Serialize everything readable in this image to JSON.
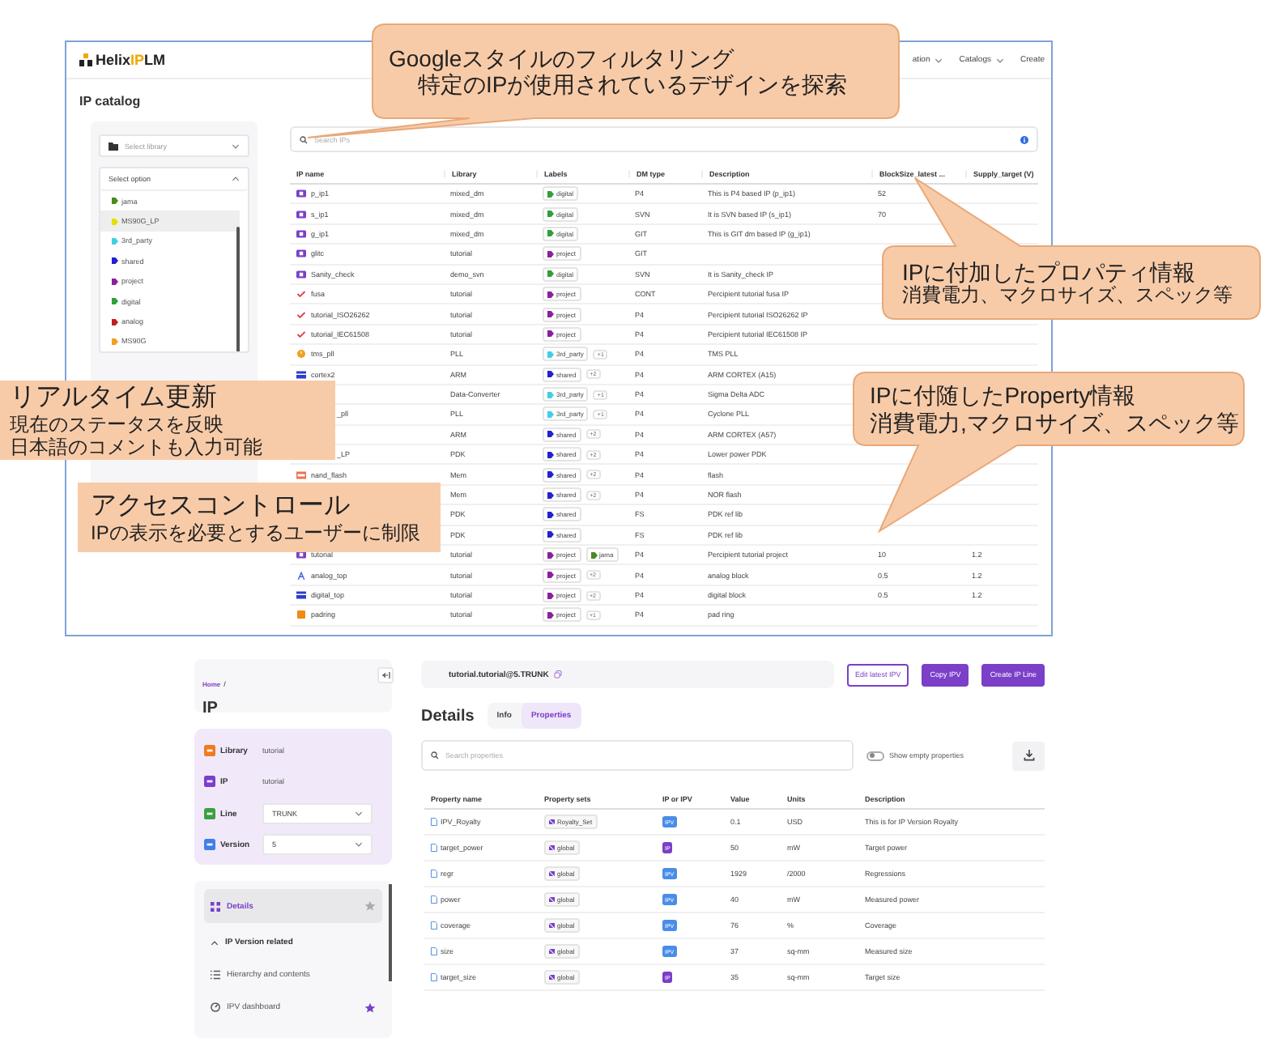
{
  "catalog_window": {
    "header": {
      "logo": {
        "part_1": "Helix",
        "part_2": "IP",
        "part_3": "LM"
      },
      "nav": [
        {
          "label": "ation",
          "dropdown": true
        },
        {
          "label": "Catalogs",
          "dropdown": true
        },
        {
          "label": "Create",
          "dropdown": false
        }
      ]
    },
    "title": "IP catalog",
    "library_select": {
      "placeholder": "Select library"
    },
    "option_select": {
      "placeholder": "Select option",
      "expanded": true,
      "options": [
        {
          "label": "jama",
          "color": "#4a8a20",
          "selected": false
        },
        {
          "label": "MS90G_LP",
          "color": "#e3e000",
          "selected": true
        },
        {
          "label": "3rd_party",
          "color": "#40cfe6",
          "selected": false
        },
        {
          "label": "shared",
          "color": "#2222d0",
          "selected": false
        },
        {
          "label": "project",
          "color": "#8a20a0",
          "selected": false
        },
        {
          "label": "digital",
          "color": "#2fa03a",
          "selected": false
        },
        {
          "label": "analog",
          "color": "#c02020",
          "selected": false
        },
        {
          "label": "MS90G",
          "color": "#f0a020",
          "selected": false
        }
      ]
    },
    "search": {
      "placeholder": "Search IPs"
    },
    "table": {
      "columns": [
        "IP name",
        "Library",
        "Labels",
        "DM type",
        "Description",
        "BlockSize_latest ...",
        "Supply_target (V)"
      ],
      "rows": [
        {
          "kind": "chip",
          "name": "p_ip1",
          "library": "mixed_dm",
          "labels": [
            {
              "text": "digital",
              "color": "#2fa03a"
            }
          ],
          "dm": "P4",
          "description": "This is P4 based IP (p_ip1)",
          "blocksize": "52"
        },
        {
          "kind": "chip",
          "name": "s_ip1",
          "library": "mixed_dm",
          "labels": [
            {
              "text": "digital",
              "color": "#2fa03a"
            }
          ],
          "dm": "SVN",
          "description": "It is SVN based IP (s_ip1)",
          "blocksize": "70"
        },
        {
          "kind": "chip",
          "name": "g_ip1",
          "library": "mixed_dm",
          "labels": [
            {
              "text": "digital",
              "color": "#2fa03a"
            }
          ],
          "dm": "GIT",
          "description": "This is GIT dm based IP (g_ip1)"
        },
        {
          "kind": "chip",
          "name": "glitc",
          "library": "tutorial",
          "labels": [
            {
              "text": "project",
              "color": "#8a20a0"
            }
          ],
          "dm": "GIT"
        },
        {
          "kind": "chip",
          "name": "Sanity_check",
          "library": "demo_svn",
          "labels": [
            {
              "text": "digital",
              "color": "#2fa03a"
            }
          ],
          "dm": "SVN",
          "description": "It is Sanity_check IP"
        },
        {
          "kind": "check",
          "name": "fusa",
          "library": "tutorial",
          "labels": [
            {
              "text": "project",
              "color": "#8a20a0"
            }
          ],
          "dm": "CONT",
          "description": "Percipient tutorial fusa IP"
        },
        {
          "kind": "check",
          "name": "tutorial_ISO26262",
          "library": "tutorial",
          "labels": [
            {
              "text": "project",
              "color": "#8a20a0"
            }
          ],
          "dm": "P4",
          "description": "Percipient tutorial ISO26262 IP"
        },
        {
          "kind": "check",
          "name": "tutorial_IEC61508",
          "library": "tutorial",
          "labels": [
            {
              "text": "project",
              "color": "#8a20a0"
            }
          ],
          "dm": "P4",
          "description": "Percipient tutorial IEC61508 IP"
        },
        {
          "kind": "dial",
          "name": "tms_pll",
          "library": "PLL",
          "labels": [
            {
              "text": "3rd_party",
              "color": "#40cfe6"
            }
          ],
          "more": "+1",
          "dm": "P4",
          "description": "TMS PLL"
        },
        {
          "kind": "block",
          "name": "cortex2",
          "library": "ARM",
          "labels": [
            {
              "text": "shared",
              "color": "#2222d0"
            }
          ],
          "more": "+2",
          "dm": "P4",
          "description": "ARM CORTEX (A15)"
        },
        {
          "library": "Data-Converter",
          "labels": [
            {
              "text": "3rd_party",
              "color": "#40cfe6"
            }
          ],
          "more": "+1",
          "dm": "P4",
          "description": "Sigma Delta ADC"
        },
        {
          "name": "_pll",
          "library": "PLL",
          "labels": [
            {
              "text": "3rd_party",
              "color": "#40cfe6"
            }
          ],
          "more": "+1",
          "dm": "P4",
          "description": "Cyclone PLL"
        },
        {
          "library": "ARM",
          "labels": [
            {
              "text": "shared",
              "color": "#2222d0"
            }
          ],
          "more": "+2",
          "dm": "P4",
          "description": "ARM CORTEX (A57)"
        },
        {
          "name": "_LP",
          "library": "PDK",
          "labels": [
            {
              "text": "shared",
              "color": "#2222d0"
            }
          ],
          "more": "+2",
          "dm": "P4",
          "description": "Lower power PDK"
        },
        {
          "kind": "memory",
          "name": "nand_flash",
          "library": "Mem",
          "labels": [
            {
              "text": "shared",
              "color": "#2222d0"
            }
          ],
          "more": "+2",
          "dm": "P4",
          "description": "flash"
        },
        {
          "library": "Mem",
          "labels": [
            {
              "text": "shared",
              "color": "#2222d0"
            }
          ],
          "more": "+2",
          "dm": "P4",
          "description": "NOR flash"
        },
        {
          "library": "PDK",
          "labels": [
            {
              "text": "shared",
              "color": "#2222d0"
            }
          ],
          "dm": "FS",
          "description": "PDK ref lib"
        },
        {
          "library": "PDK",
          "labels": [
            {
              "text": "shared",
              "color": "#2222d0"
            }
          ],
          "dm": "FS",
          "description": "PDK ref lib"
        },
        {
          "kind": "chip",
          "name": "tutorial",
          "library": "tutorial",
          "labels": [
            {
              "text": "project",
              "color": "#8a20a0"
            },
            {
              "text": "jama",
              "color": "#4a8a20"
            }
          ],
          "dm": "P4",
          "description": "Percipient tutorial project",
          "blocksize": "10",
          "supply": "1.2"
        },
        {
          "kind": "analog",
          "name": "analog_top",
          "library": "tutorial",
          "labels": [
            {
              "text": "project",
              "color": "#8a20a0"
            }
          ],
          "more": "+2",
          "dm": "P4",
          "description": "analog block",
          "blocksize": "0.5",
          "supply": "1.2"
        },
        {
          "kind": "block",
          "name": "digital_top",
          "library": "tutorial",
          "labels": [
            {
              "text": "project",
              "color": "#8a20a0"
            }
          ],
          "more": "+2",
          "dm": "P4",
          "description": "digital block",
          "blocksize": "0.5",
          "supply": "1.2"
        },
        {
          "kind": "square",
          "name": "padring",
          "library": "tutorial",
          "labels": [
            {
              "text": "project",
              "color": "#8a20a0"
            }
          ],
          "more": "+1",
          "dm": "P4",
          "description": "pad ring"
        }
      ]
    }
  },
  "ip_window": {
    "breadcrumb": "Home",
    "breadcrumb_separator": "/",
    "page_title": "IP",
    "fields": [
      {
        "label": "Library",
        "kind": "text",
        "value": "tutorial"
      },
      {
        "label": "IP",
        "kind": "text",
        "value": "tutorial"
      },
      {
        "label": "Line",
        "kind": "select",
        "value": "TRUNK"
      },
      {
        "label": "Version",
        "kind": "select",
        "value": "5"
      }
    ],
    "nav": [
      {
        "kind": "grid",
        "label": "Details",
        "selected": true,
        "starred": false
      },
      {
        "kind": "group",
        "label": "IP Version related",
        "expanded": true
      },
      {
        "kind": "list",
        "label": "Hierarchy and contents",
        "selected": false
      },
      {
        "kind": "dashboard",
        "label": "IPV dashboard",
        "selected": false,
        "starred": true
      }
    ],
    "ip_path": "tutorial.tutorial@5.TRUNK",
    "buttons": [
      {
        "label": "Edit latest IPV",
        "kind": "outline"
      },
      {
        "label": "Copy IPV",
        "kind": "primary"
      },
      {
        "label": "Create IP Line",
        "kind": "primary"
      }
    ],
    "heading": "Details",
    "tabs": [
      {
        "label": "Info",
        "selected": false
      },
      {
        "label": "Properties",
        "selected": true
      }
    ],
    "search": {
      "placeholder": "Search properties"
    },
    "toggle": {
      "label": "Show empty properties",
      "on": false
    },
    "table": {
      "columns": [
        "Property name",
        "Property sets",
        "IP or IPV",
        "Value",
        "Units",
        "Description"
      ],
      "rows": [
        {
          "name": "IPV_Royalty",
          "set": "Royalty_Set",
          "scope": "IPV",
          "kind": "version",
          "value": "0.1",
          "units": "USD",
          "description": "This is for IP Version Royalty"
        },
        {
          "name": "target_power",
          "set": "global",
          "scope": "IP",
          "kind": "ip",
          "value": "50",
          "units": "mW",
          "description": "Target power"
        },
        {
          "name": "regr",
          "set": "global",
          "scope": "IPV",
          "kind": "version",
          "value": "1929",
          "units": "/2000",
          "description": "Regressions"
        },
        {
          "name": "power",
          "set": "global",
          "scope": "IPV",
          "kind": "version",
          "value": "40",
          "units": "mW",
          "description": "Measured power"
        },
        {
          "name": "coverage",
          "set": "global",
          "scope": "IPV",
          "kind": "version",
          "value": "76",
          "units": "%",
          "description": "Coverage"
        },
        {
          "name": "size",
          "set": "global",
          "scope": "IPV",
          "kind": "version",
          "value": "37",
          "units": "sq-mm",
          "description": "Measured size"
        },
        {
          "name": "target_size",
          "set": "global",
          "scope": "IP",
          "kind": "ip",
          "value": "35",
          "units": "sq-mm",
          "description": "Target size"
        }
      ]
    }
  },
  "callouts": [
    {
      "kind": "bubble",
      "lines": [
        "Googleスタイルのフィルタリング",
        "特定のIPが使用されているデザインを探索"
      ]
    },
    {
      "kind": "bubble",
      "lines": [
        "IPに付加したプロパティ情報",
        "消費電力、マクロサイズ、スペック等"
      ]
    },
    {
      "kind": "box",
      "lines": [
        "リアルタイム更新",
        "現在のステータスを反映",
        "日本語のコメントも入力可能"
      ]
    },
    {
      "kind": "box",
      "lines": [
        "アクセスコントロール",
        "IPの表示を必要とするユーザーに制限"
      ]
    },
    {
      "kind": "bubble",
      "lines": [
        "IPに付随したProperty情報",
        "消費電力,マクロサイズ、スペック等"
      ]
    }
  ]
}
